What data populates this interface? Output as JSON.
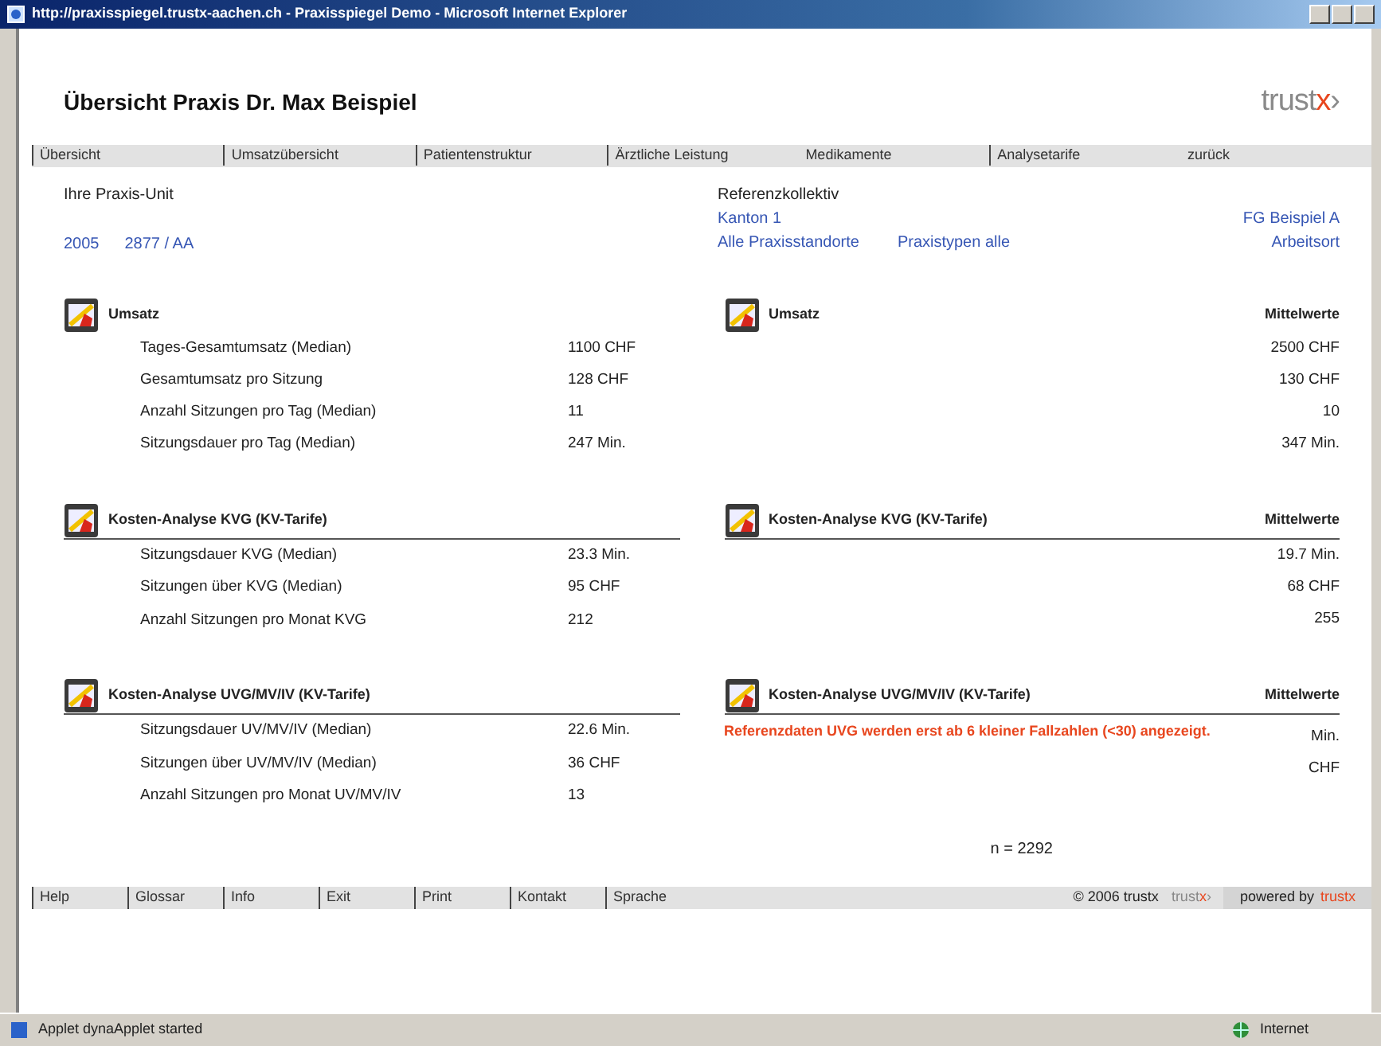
{
  "window": {
    "title": "http://praxisspiegel.trustx-aachen.ch - Praxisspiegel Demo - Microsoft Internet Explorer"
  },
  "page": {
    "title": "Übersicht Praxis Dr. Max Beispiel",
    "logo": "trust",
    "logo_accent": "x",
    "logo_mark": "›"
  },
  "nav": [
    {
      "label": "Übersicht",
      "divider": true
    },
    {
      "label": "Umsatzübersicht",
      "divider": true
    },
    {
      "label": "Patientenstruktur",
      "divider": true
    },
    {
      "label": "Ärztliche Leistung",
      "divider": true
    },
    {
      "label": "Medikamente",
      "divider": false
    },
    {
      "label": "Analysetarife",
      "divider": true
    },
    {
      "label": "zurück",
      "divider": false
    }
  ],
  "unit": {
    "label": "Ihre Praxis-Unit",
    "year": "2005",
    "code": "2877 / AA"
  },
  "reference": {
    "label": "Referenzkollektiv",
    "region": "Kanton 1",
    "group": "FG Beispiel A",
    "locations": "Alle Praxisstandorte",
    "types": "Praxistypen alle",
    "workplace": "Arbeitsort"
  },
  "sections": [
    {
      "title": "Umsatz",
      "underline": false,
      "rows": [
        {
          "label": "Tages-Gesamtumsatz (Median)",
          "value": "1100 CHF"
        },
        {
          "label": "Gesamtumsatz pro Sitzung",
          "value": "128 CHF"
        },
        {
          "label": "Anzahl Sitzungen pro Tag (Median)",
          "value": "11"
        },
        {
          "label": "Sitzungsdauer pro Tag (Median)",
          "value": "247 Min."
        }
      ],
      "ref_title": "Umsatz",
      "ref_header": "Mittelwerte",
      "ref_values": [
        "2500 CHF",
        "130 CHF",
        "10",
        "347 Min."
      ]
    },
    {
      "title": "Kosten-Analyse KVG (KV-Tarife)",
      "underline": true,
      "rows": [
        {
          "label": "Sitzungsdauer KVG (Median)",
          "value": "23.3 Min."
        },
        {
          "label": "Sitzungen über KVG (Median)",
          "value": "95 CHF"
        },
        {
          "label": "Anzahl Sitzungen pro Monat KVG",
          "value": "212"
        }
      ],
      "ref_title": "Kosten-Analyse KVG (KV-Tarife)",
      "ref_header": "Mittelwerte",
      "ref_values": [
        "19.7 Min.",
        "68 CHF",
        "255"
      ]
    },
    {
      "title": "Kosten-Analyse UVG/MV/IV (KV-Tarife)",
      "underline": true,
      "rows": [
        {
          "label": "Sitzungsdauer UV/MV/IV (Median)",
          "value": "22.6 Min."
        },
        {
          "label": "Sitzungen über UV/MV/IV (Median)",
          "value": "36 CHF"
        },
        {
          "label": "Anzahl Sitzungen pro Monat UV/MV/IV",
          "value": "13"
        }
      ],
      "ref_title": "Kosten-Analyse UVG/MV/IV (KV-Tarife)",
      "ref_header": "Mittelwerte",
      "ref_note": "Referenzdaten UVG werden erst ab 6 kleiner Fallzahlen (<30) angezeigt.",
      "ref_values": [
        "Min.",
        "CHF"
      ]
    }
  ],
  "sample": "n = 2292",
  "footer": {
    "links": [
      "Help",
      "Glossar",
      "Info",
      "Exit",
      "Print",
      "Kontakt",
      "Sprache"
    ],
    "copyright": "© 2006 trustx",
    "brand": "trust",
    "brand_accent": "x",
    "brand_mark": "›",
    "powered": "powered by",
    "powered_brand": "trustx"
  },
  "status_bar": {
    "text": "Applet dynaApplet started",
    "zone": "Internet"
  }
}
